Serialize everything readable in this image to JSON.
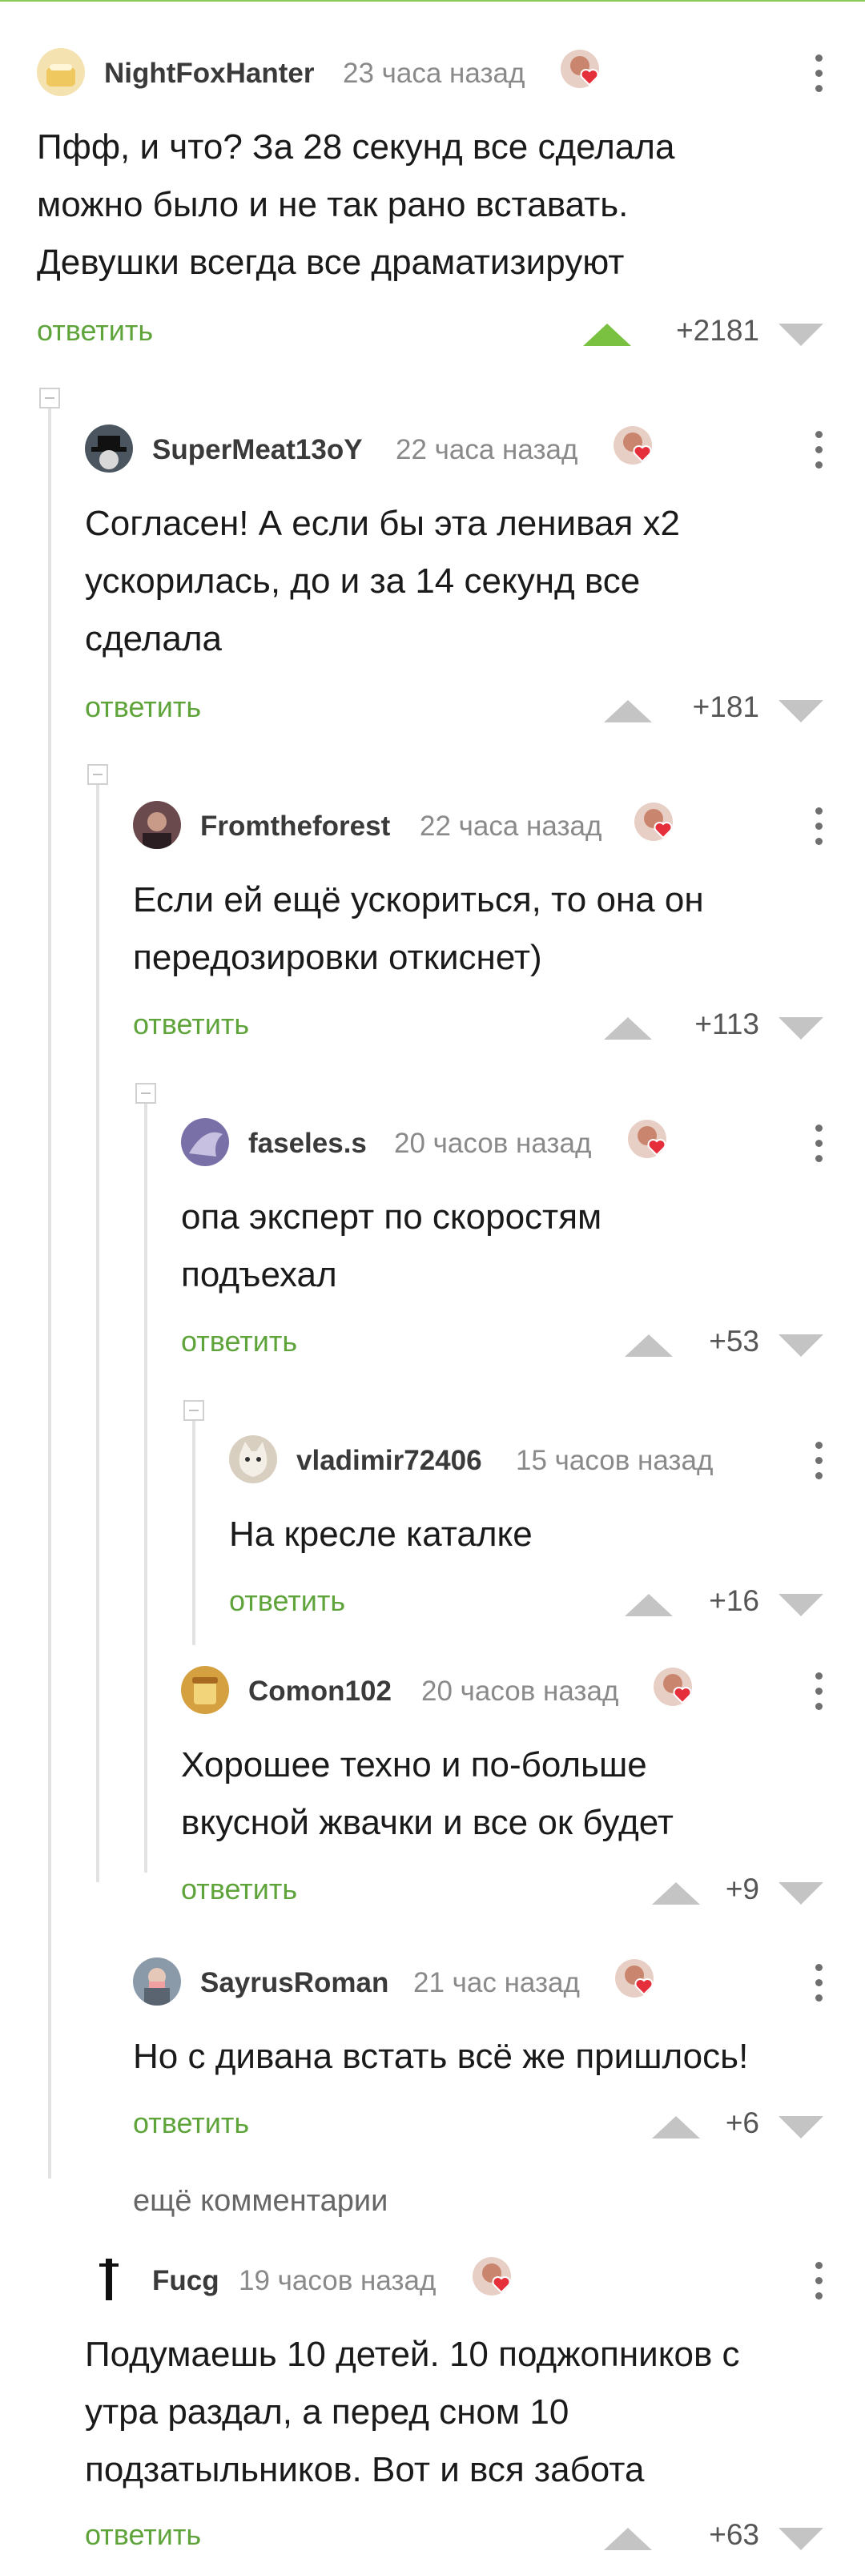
{
  "reply_label": "ответить",
  "more_comments": "ещё комментарии",
  "comments": [
    {
      "user": "NightFoxHanter",
      "time": "23 часа назад",
      "lines": [
        "Пфф, и что? За 28 секунд все сделала",
        "можно было и не так рано вставать.",
        "Девушки всегда все драматизируют"
      ],
      "score": "+2181",
      "upvoted": true,
      "avatar_icon": "bread-avatar",
      "avatar_color": "#f4e3b0"
    },
    {
      "user": "SuperMeat13oY",
      "time": "22 часа назад",
      "lines": [
        "Согласен! А если бы эта ленивая х2",
        "ускорилась, до и за 14 секунд все",
        "сделала"
      ],
      "score": "+181",
      "upvoted": false,
      "avatar_icon": "hat-avatar",
      "avatar_color": "#4a5560"
    },
    {
      "user": "Fromtheforest",
      "time": "22 часа назад",
      "lines": [
        "Если ей ещё ускориться, то она он",
        "передозировки откиснет)"
      ],
      "score": "+113",
      "upvoted": false,
      "avatar_icon": "face-avatar",
      "avatar_color": "#6b4a4e"
    },
    {
      "user": "faseles.s",
      "time": "20 часов назад",
      "lines": [
        "опа эксперт по скоростям",
        "подъехал"
      ],
      "score": "+53",
      "upvoted": false,
      "avatar_icon": "bird-avatar",
      "avatar_color": "#7a70a8"
    },
    {
      "user": "vladimir72406",
      "time": "15 часов назад",
      "lines": [
        "На кресле каталке"
      ],
      "score": "+16",
      "upvoted": false,
      "avatar_icon": "cat-avatar",
      "avatar_color": "#d9cfc0"
    },
    {
      "user": "Comon102",
      "time": "20 часов назад",
      "lines": [
        "Хорошее техно и по-больше",
        "вкусной жвачки и все ок будет"
      ],
      "score": "+9",
      "upvoted": false,
      "avatar_icon": "cup-avatar",
      "avatar_color": "#d4a040"
    },
    {
      "user": "SayrusRoman",
      "time": "21 час назад",
      "lines": [
        "Но с дивана встать всё же пришлось!"
      ],
      "score": "+6",
      "upvoted": false,
      "avatar_icon": "person-avatar",
      "avatar_color": "#8a9aa8"
    },
    {
      "user": "Fucg",
      "time": "19 часов назад",
      "lines": [
        "Подумаешь 10 детей. 10 поджопников с",
        "утра раздал, а перед сном 10",
        "подзатыльников. Вот и вся забота"
      ],
      "score": "+63",
      "upvoted": false,
      "avatar_icon": "figure-avatar",
      "avatar_color": "#ffffff"
    }
  ]
}
